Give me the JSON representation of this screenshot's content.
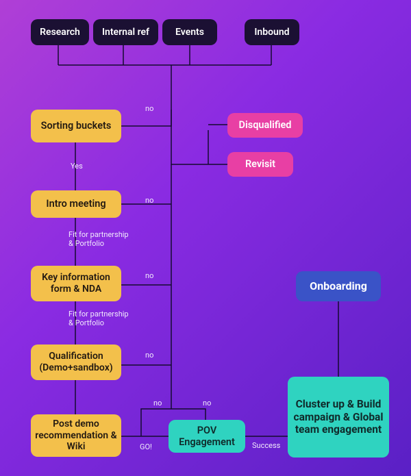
{
  "sources": {
    "research": "Research",
    "internal_ref": "Internal ref",
    "events": "Events",
    "inbound": "Inbound"
  },
  "stages": {
    "sorting": "Sorting buckets",
    "intro": "Intro meeting",
    "key_info": "Key information form & NDA",
    "qualification": "Qualification (Demo+sandbox)",
    "post_demo": "Post demo recommendation & Wiki",
    "pov": "POV Engagement",
    "cluster": "Cluster up & Build campaign & Global team engagement",
    "onboarding": "Onboarding"
  },
  "results": {
    "disqualified": "Disqualified",
    "revisit": "Revisit"
  },
  "labels": {
    "no": "no",
    "yes": "Yes",
    "fit": "Fit for partnership\n& Portfolio",
    "go": "GO!",
    "success": "Success"
  }
}
